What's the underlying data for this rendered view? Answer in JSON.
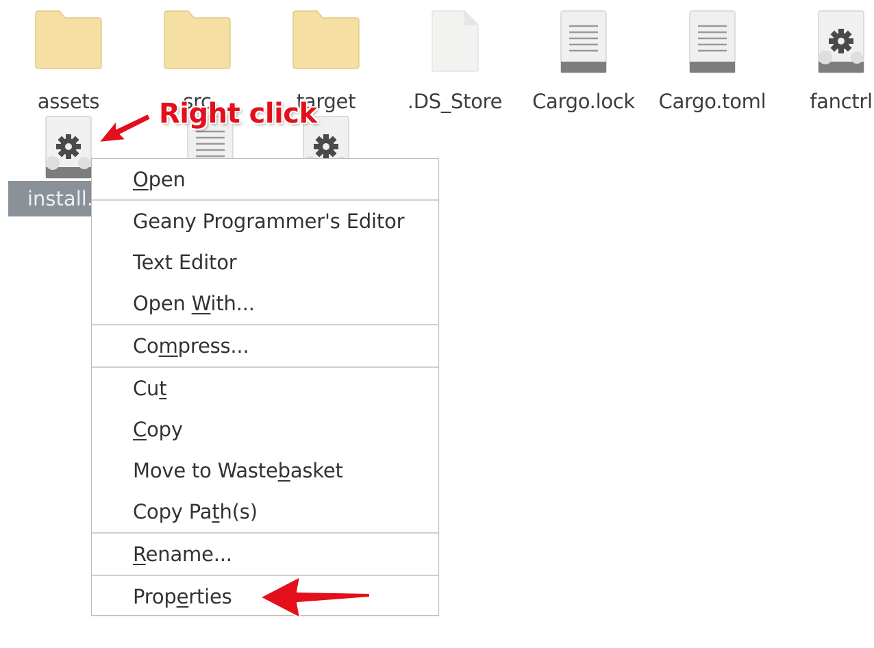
{
  "files_row1": [
    {
      "name": "assets",
      "type": "folder"
    },
    {
      "name": "src",
      "type": "folder"
    },
    {
      "name": "target",
      "type": "folder"
    },
    {
      "name": ".DS_Store",
      "type": "blank-file"
    },
    {
      "name": "Cargo.lock",
      "type": "text-file"
    },
    {
      "name": "Cargo.toml",
      "type": "text-file"
    },
    {
      "name": "fanctrl",
      "type": "executable-file"
    }
  ],
  "files_row2": [
    {
      "name": "install.",
      "type": "executable-file",
      "selected": true
    },
    {
      "name": "",
      "type": "text-file"
    },
    {
      "name": "",
      "type": "executable-file"
    }
  ],
  "context_menu": {
    "items": [
      {
        "pre": "",
        "mn": "O",
        "post": "pen",
        "group": 1
      },
      {
        "pre": "Geany Programmer's Editor",
        "mn": "",
        "post": "",
        "group": 2
      },
      {
        "pre": "Text Editor",
        "mn": "",
        "post": "",
        "group": 2
      },
      {
        "pre": "Open ",
        "mn": "W",
        "post": "ith...",
        "group": 2
      },
      {
        "pre": "Co",
        "mn": "m",
        "post": "press...",
        "group": 3
      },
      {
        "pre": "Cu",
        "mn": "t",
        "post": "",
        "group": 4
      },
      {
        "pre": "",
        "mn": "C",
        "post": "opy",
        "group": 4
      },
      {
        "pre": "Move to Waste",
        "mn": "b",
        "post": "asket",
        "group": 4
      },
      {
        "pre": "Copy Pa",
        "mn": "t",
        "post": "h(s)",
        "group": 4
      },
      {
        "pre": "",
        "mn": "R",
        "post": "ename...",
        "group": 5
      },
      {
        "pre": "Prop",
        "mn": "e",
        "post": "rties",
        "group": 6
      }
    ]
  },
  "annotation": {
    "text": "Right click",
    "color": "#e3101c"
  },
  "colors": {
    "folder": "#f5dfa2",
    "selection": "#8a9198",
    "menu_border": "#bdbdbd"
  }
}
